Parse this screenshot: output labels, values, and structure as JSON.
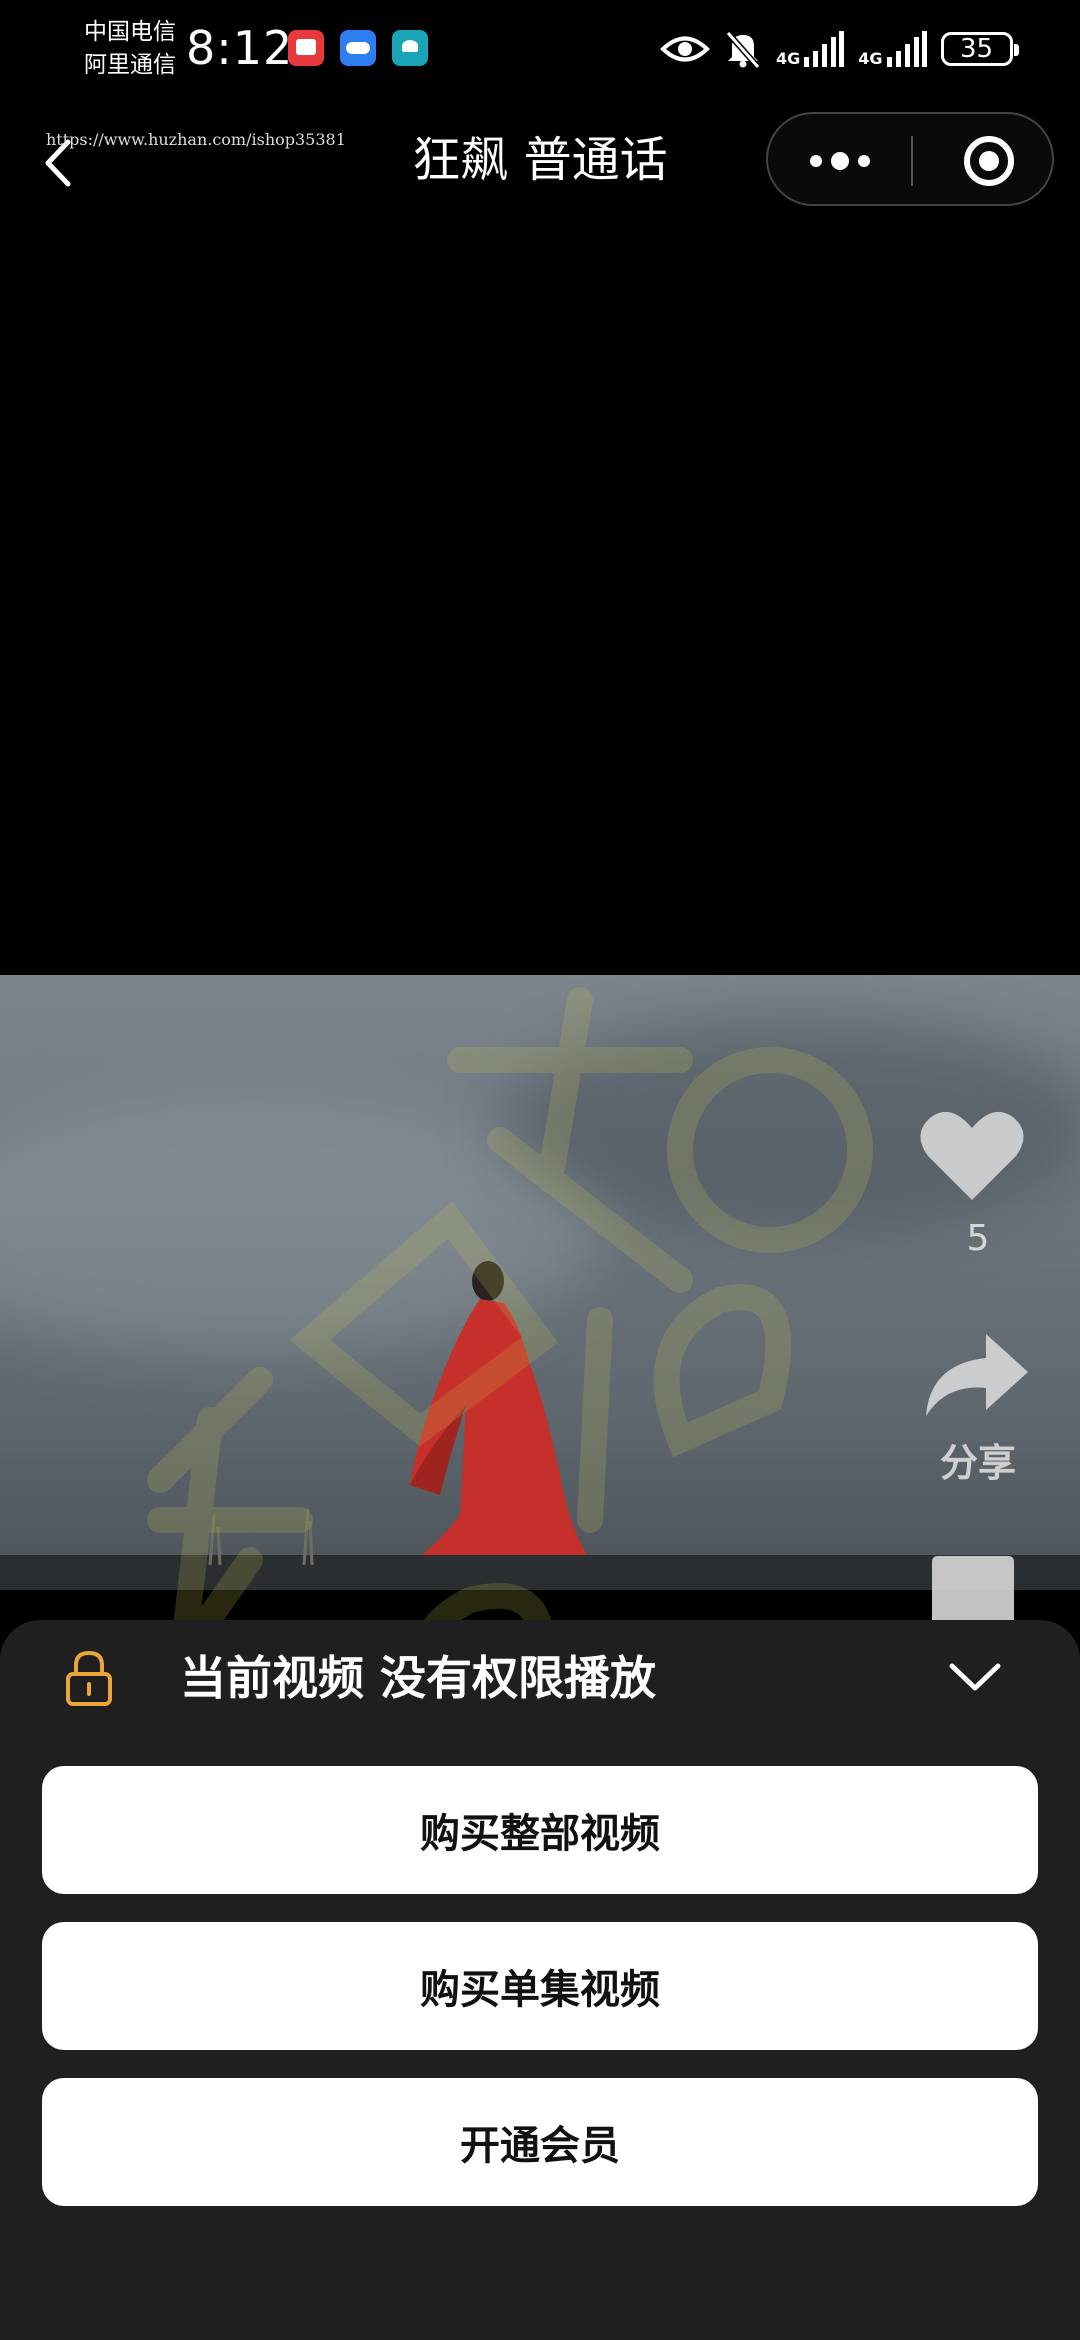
{
  "status_bar": {
    "carrier_1": "中国电信",
    "carrier_2": "阿里通信",
    "time": "8:12",
    "network_1": "4G",
    "network_2": "4G",
    "battery": "35"
  },
  "nav": {
    "url_overlay": "https://www.huzhan.com/ishop35381",
    "title": "狂飙 普通话"
  },
  "video": {
    "like_count": "5",
    "share_label": "分享"
  },
  "sheet": {
    "message": "当前视频 没有权限播放",
    "buttons": [
      "购买整部视频",
      "购买单集视频",
      "开通会员"
    ]
  },
  "colors": {
    "lock_icon": "#e9a43a",
    "sheet_bg": "#1f1f1f",
    "button_bg": "#ffffff"
  }
}
